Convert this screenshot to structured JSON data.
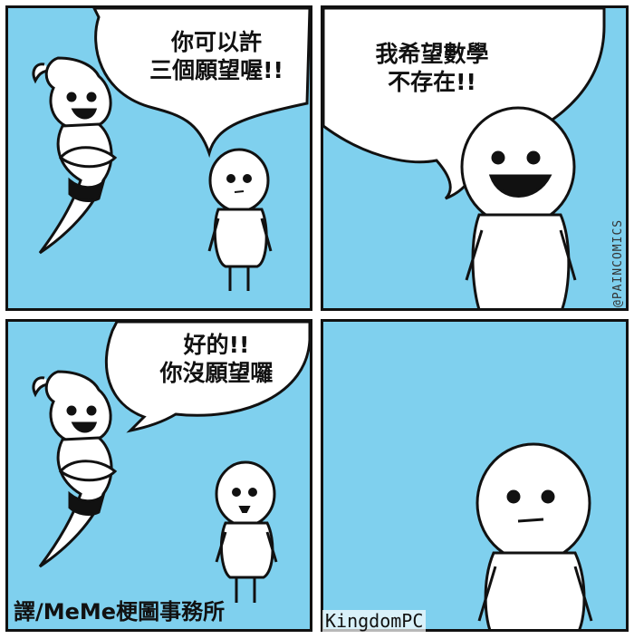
{
  "colors": {
    "panel_bg": "#7fd0ee",
    "line": "#111111",
    "figure": "#ffffff"
  },
  "panels": [
    {
      "bubble": "你可以許\n三個願望喔!!"
    },
    {
      "bubble": "我希望數學\n不存在!!"
    },
    {
      "bubble": "好的!!\n你沒願望囉"
    },
    {
      "bubble": ""
    }
  ],
  "credits": {
    "translator": "譯/MeMe梗圖事務所",
    "watermark": "KingdomPC",
    "artist": "@PAINCOMICS"
  }
}
